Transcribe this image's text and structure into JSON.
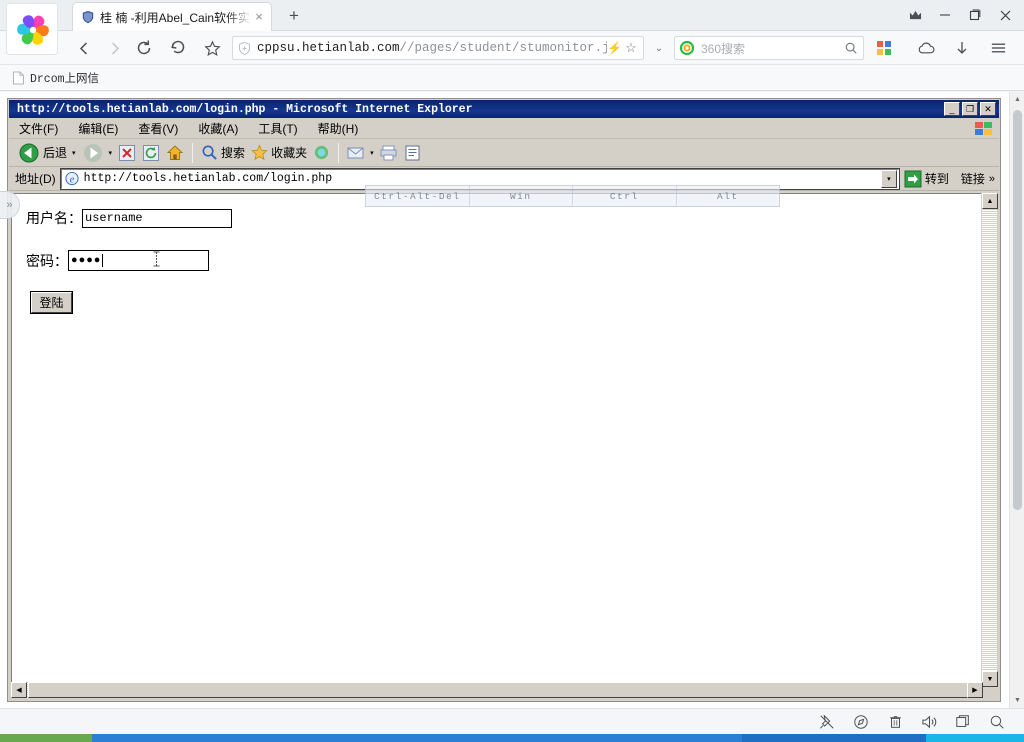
{
  "browser": {
    "logo_icon": "360-pinwheel-logo",
    "tab": {
      "title": "桂 楠 -利用Abel_Cain软件实",
      "favicon": "shield-icon",
      "close_icon": "×"
    },
    "new_tab_label": "+",
    "window_controls": [
      {
        "name": "crown-icon",
        "glyph": "♛"
      },
      {
        "name": "minimize-icon",
        "glyph": "—"
      },
      {
        "name": "maximize-icon",
        "glyph": "❐"
      },
      {
        "name": "close-icon",
        "glyph": "✕"
      }
    ],
    "nav": {
      "back_glyph": "‹",
      "forward_glyph": "›",
      "reload_glyph": "⟳",
      "undo_glyph": "↺",
      "star_glyph": "☆"
    },
    "url": {
      "shield_icon": "shield-icon",
      "host": "cppsu.hetianlab.com",
      "path": "//pages/student/stumonitor.js",
      "bolt_icon": "⚡",
      "star_icon": "☆",
      "dropdown_icon": "⌄"
    },
    "search": {
      "engine_icon": "360-search-logo",
      "placeholder": "360搜索",
      "search_icon": "search-icon"
    },
    "right_icons": [
      {
        "name": "apps-grid-icon",
        "glyph": "▦"
      },
      {
        "name": "cloud-icon",
        "glyph": "☁"
      },
      {
        "name": "download-icon",
        "glyph": "↓"
      },
      {
        "name": "menu-icon",
        "glyph": "☰"
      }
    ],
    "bookmarks": [
      {
        "label": "Drcom上网信",
        "icon": "page-icon"
      }
    ],
    "page_scrollbar": {
      "up_glyph": "▲",
      "down_glyph": "▼"
    }
  },
  "remote": {
    "edge_handle_glyph": "»",
    "keybar": [
      {
        "label": "Ctrl-Alt-Del"
      },
      {
        "label": "Win"
      },
      {
        "label": "Ctrl"
      },
      {
        "label": "Alt"
      }
    ]
  },
  "ie": {
    "title": "http://tools.hetianlab.com/login.php - Microsoft Internet Explorer",
    "title_buttons": [
      {
        "name": "ie-minimize-button",
        "glyph": "_"
      },
      {
        "name": "ie-restore-button",
        "glyph": "❐"
      },
      {
        "name": "ie-close-button",
        "glyph": "✕"
      }
    ],
    "menu": [
      {
        "label": "文件(F)"
      },
      {
        "label": "编辑(E)"
      },
      {
        "label": "查看(V)"
      },
      {
        "label": "收藏(A)"
      },
      {
        "label": "工具(T)"
      },
      {
        "label": "帮助(H)"
      }
    ],
    "toolbar": {
      "back_label": "后退",
      "search_label": "搜索",
      "favorites_label": "收藏夹",
      "dropdown_glyph": "▾"
    },
    "address": {
      "label": "地址(D)",
      "url": "http://tools.hetianlab.com/login.php",
      "favicon": "ie-e-icon",
      "dropdown_glyph": "▾",
      "go_label": "转到",
      "links_label": "链接",
      "chevrons": "»"
    },
    "page": {
      "username_label": "用户名：",
      "username_value": "username",
      "password_label": "密码：",
      "password_value": "●●●●",
      "login_button": "登陆"
    },
    "scroll": {
      "up_glyph": "▲",
      "down_glyph": "▼",
      "left_glyph": "◀",
      "right_glyph": "▶"
    }
  },
  "statusbar": {
    "icons": [
      {
        "name": "pin-off-icon",
        "glyph": "⚲"
      },
      {
        "name": "compass-icon",
        "glyph": "◍"
      },
      {
        "name": "trash-icon",
        "glyph": "🗑"
      },
      {
        "name": "speaker-icon",
        "glyph": "🔊"
      },
      {
        "name": "windows-icon",
        "glyph": "❐"
      },
      {
        "name": "search-icon",
        "glyph": "⌕"
      }
    ]
  },
  "colors": {
    "ie_titlebar": "#0a246a",
    "ie_face": "#d4d0c8",
    "accent_green": "#6aa84f",
    "accent_blue": "#2b7fd4",
    "accent_cyan": "#1ab6e8"
  }
}
